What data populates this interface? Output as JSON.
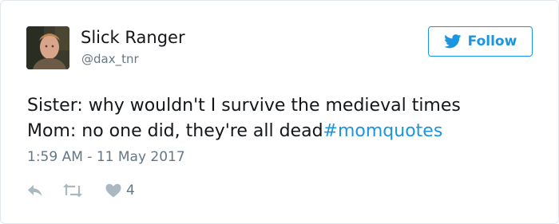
{
  "user": {
    "display_name": "Slick Ranger",
    "handle": "@dax_tnr"
  },
  "follow_button": {
    "label": "Follow",
    "icon": "twitter-bird-icon"
  },
  "tweet": {
    "line1": "Sister: why wouldn't I survive the medieval times",
    "line2": "Mom: no one did, they're all dead",
    "hashtag": "#momquotes",
    "timestamp": "1:59 AM - 11 May 2017"
  },
  "actions": {
    "reply_icon": "reply-icon",
    "retweet_icon": "retweet-icon",
    "like_icon": "heart-icon",
    "like_count": "4"
  },
  "colors": {
    "accent": "#1b95e0",
    "text": "#14171a",
    "muted": "#657786",
    "icon": "#aab8c2",
    "border": "#e1e8ed"
  }
}
